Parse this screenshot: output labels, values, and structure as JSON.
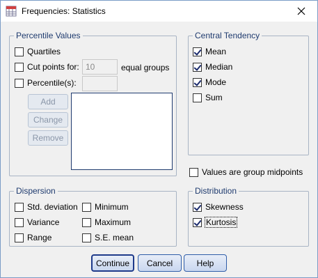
{
  "window": {
    "title": "Frequencies: Statistics",
    "icon": "statistics-icon",
    "close_icon": "close-icon"
  },
  "percentile_values": {
    "legend": "Percentile Values",
    "quartiles": {
      "label": "Quartiles",
      "checked": false
    },
    "cut_points": {
      "label": "Cut points for:",
      "value": "10",
      "suffix": "equal groups",
      "checked": false
    },
    "percentiles": {
      "label": "Percentile(s):",
      "value": "",
      "checked": false
    },
    "buttons": {
      "add": "Add",
      "change": "Change",
      "remove": "Remove"
    }
  },
  "central_tendency": {
    "legend": "Central Tendency",
    "mean": {
      "label": "Mean",
      "checked": true
    },
    "median": {
      "label": "Median",
      "checked": true
    },
    "mode": {
      "label": "Mode",
      "checked": true
    },
    "sum": {
      "label": "Sum",
      "checked": false
    }
  },
  "group_midpoints": {
    "label": "Values are group midpoints",
    "checked": false
  },
  "dispersion": {
    "legend": "Dispersion",
    "std_deviation": {
      "label": "Std. deviation",
      "checked": false
    },
    "minimum": {
      "label": "Minimum",
      "checked": false
    },
    "variance": {
      "label": "Variance",
      "checked": false
    },
    "maximum": {
      "label": "Maximum",
      "checked": false
    },
    "range": {
      "label": "Range",
      "checked": false
    },
    "se_mean": {
      "label": "S.E. mean",
      "checked": false
    }
  },
  "distribution": {
    "legend": "Distribution",
    "skewness": {
      "label": "Skewness",
      "checked": true
    },
    "kurtosis": {
      "label": "Kurtosis",
      "checked": true
    }
  },
  "footer": {
    "continue": "Continue",
    "cancel": "Cancel",
    "help": "Help"
  }
}
